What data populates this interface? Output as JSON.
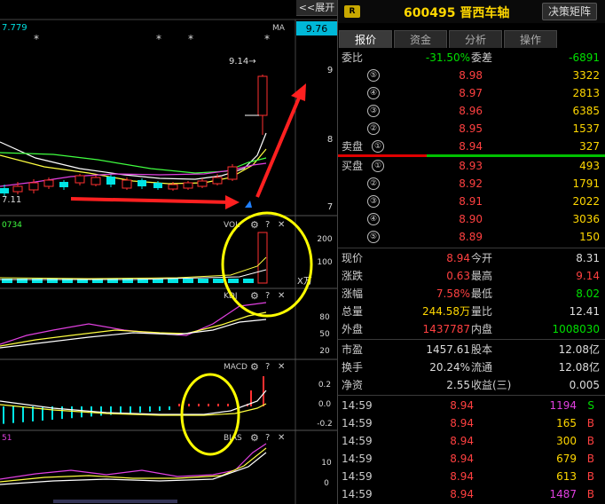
{
  "chart": {
    "expand_btn": "<<展开",
    "ma_value": "7.779",
    "ma_label": "MA",
    "price_tag": "9.76",
    "high_annot": "9.14",
    "low_annot": "7.11",
    "vol_value": "0734",
    "bias_value": "51",
    "vol_unit": "X万",
    "panels": {
      "vol": "VOL",
      "kdj": "KDJ",
      "macd": "MACD",
      "bias": "BIAS"
    },
    "y_main": [
      "9",
      "8",
      "7"
    ],
    "y_vol": [
      "200",
      "100"
    ],
    "y_kdj": [
      "80",
      "50",
      "20"
    ],
    "y_macd": [
      "0.2",
      "0.0",
      "-0.2"
    ],
    "y_bias": [
      "10",
      "0"
    ],
    "icons": {
      "gear": "⚙",
      "help": "?",
      "close": "✕"
    },
    "colors": {
      "up": "#ff3030",
      "down": "#00e5e5",
      "annot_arrow": "#ff2020",
      "highlight": "#ffff00"
    }
  },
  "header": {
    "badge": "R",
    "code": "600495 晋西车轴",
    "btn": "决策矩阵"
  },
  "tabs": [
    "报价",
    "资金",
    "分析",
    "操作"
  ],
  "weibi": {
    "label": "委比",
    "value": "-31.50%",
    "label2": "委差",
    "value2": "-6891"
  },
  "sell": [
    {
      "n": "⑤",
      "price": "8.98",
      "vol": "3322"
    },
    {
      "n": "④",
      "price": "8.97",
      "vol": "2813"
    },
    {
      "n": "③",
      "price": "8.96",
      "vol": "6385"
    },
    {
      "n": "②",
      "price": "8.95",
      "vol": "1537"
    },
    {
      "n": "①",
      "price": "8.94",
      "vol": "327",
      "label": "卖盘"
    }
  ],
  "buy": [
    {
      "n": "①",
      "price": "8.93",
      "vol": "493",
      "label": "买盘"
    },
    {
      "n": "②",
      "price": "8.92",
      "vol": "1791"
    },
    {
      "n": "③",
      "price": "8.91",
      "vol": "2022"
    },
    {
      "n": "④",
      "price": "8.90",
      "vol": "3036"
    },
    {
      "n": "⑤",
      "price": "8.89",
      "vol": "150"
    }
  ],
  "quote": [
    {
      "l1": "现价",
      "v1": "8.94",
      "c1": "red",
      "l2": "今开",
      "v2": "8.31",
      "c2": "white"
    },
    {
      "l1": "涨跌",
      "v1": "0.63",
      "c1": "red",
      "l2": "最高",
      "v2": "9.14",
      "c2": "red"
    },
    {
      "l1": "涨幅",
      "v1": "7.58%",
      "c1": "red",
      "l2": "最低",
      "v2": "8.02",
      "c2": "green"
    },
    {
      "l1": "总量",
      "v1": "244.58万",
      "c1": "yellow",
      "l2": "量比",
      "v2": "12.41",
      "c2": "white"
    },
    {
      "l1": "外盘",
      "v1": "1437787",
      "c1": "red",
      "l2": "内盘",
      "v2": "1008030",
      "c2": "green"
    }
  ],
  "fund": [
    {
      "l1": "市盈",
      "v1": "1457.61",
      "l2": "股本",
      "v2": "12.08亿"
    },
    {
      "l1": "换手",
      "v1": "20.24%",
      "l2": "流通",
      "v2": "12.08亿"
    },
    {
      "l1": "净资",
      "v1": "2.55",
      "l2": "收益(三)",
      "v2": "0.005"
    }
  ],
  "ticks": [
    {
      "time": "14:59",
      "price": "8.94",
      "vol": "1194",
      "side": "S",
      "vc": "mag",
      "sc": "green"
    },
    {
      "time": "14:59",
      "price": "8.94",
      "vol": "165",
      "side": "B",
      "vc": "yellow",
      "sc": "red"
    },
    {
      "time": "14:59",
      "price": "8.94",
      "vol": "300",
      "side": "B",
      "vc": "yellow",
      "sc": "red"
    },
    {
      "time": "14:59",
      "price": "8.94",
      "vol": "679",
      "side": "B",
      "vc": "yellow",
      "sc": "red"
    },
    {
      "time": "14:59",
      "price": "8.94",
      "vol": "613",
      "side": "B",
      "vc": "yellow",
      "sc": "red"
    },
    {
      "time": "14:59",
      "price": "8.94",
      "vol": "1487",
      "side": "B",
      "vc": "mag",
      "sc": "red"
    }
  ]
}
